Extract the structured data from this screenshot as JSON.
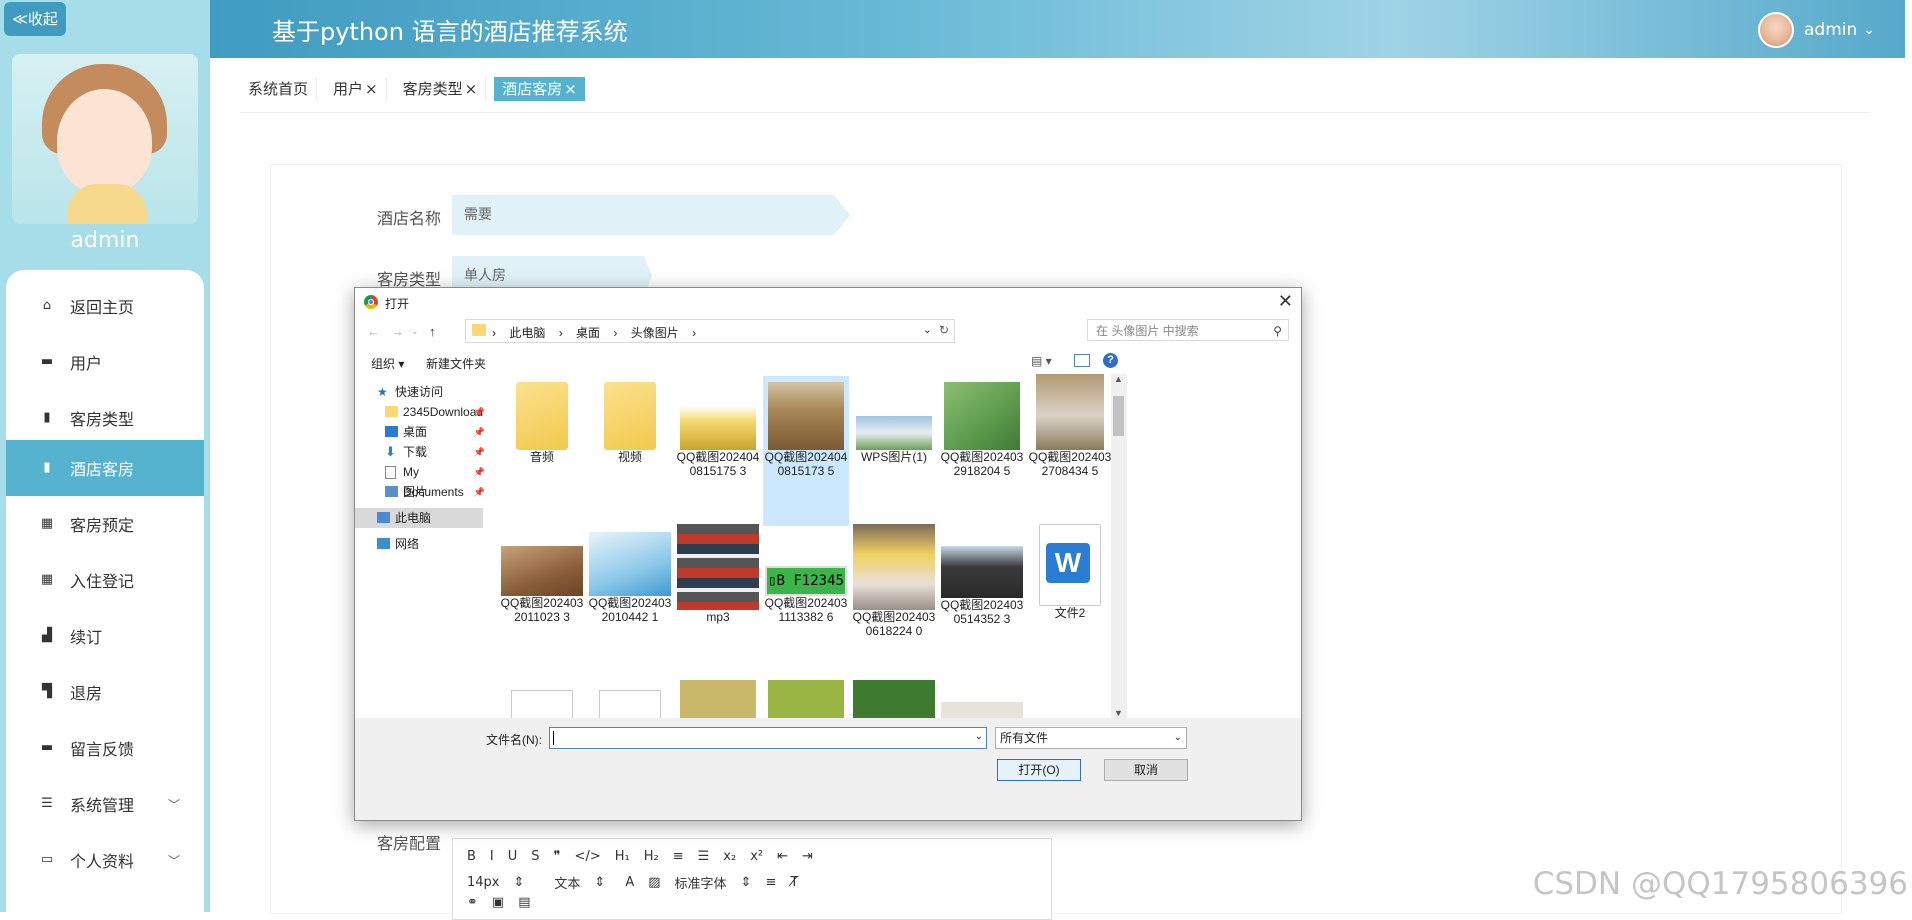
{
  "header": {
    "title": "基于python 语言的酒店推荐系统",
    "username": "admin"
  },
  "sidebar": {
    "collapse_label": "≪收起",
    "name": "admin",
    "items": [
      {
        "label": "返回主页",
        "icon": "home-icon"
      },
      {
        "label": "用户",
        "icon": "monitor-icon"
      },
      {
        "label": "客房类型",
        "icon": "clipboard-icon"
      },
      {
        "label": "酒店客房",
        "icon": "clipboard-icon"
      },
      {
        "label": "客房预定",
        "icon": "grid-icon"
      },
      {
        "label": "入住登记",
        "icon": "grid-icon"
      },
      {
        "label": "续订",
        "icon": "thumb-icon"
      },
      {
        "label": "退房",
        "icon": "thumb-icon"
      },
      {
        "label": "留言反馈",
        "icon": "monitor-icon"
      },
      {
        "label": "系统管理",
        "icon": "sliders-icon"
      },
      {
        "label": "个人资料",
        "icon": "card-icon"
      }
    ]
  },
  "tabs": [
    {
      "label": "系统首页",
      "closable": ""
    },
    {
      "label": "用户",
      "closable": "×"
    },
    {
      "label": "客房类型",
      "closable": "×"
    },
    {
      "label": "酒店客房",
      "closable": "×"
    }
  ],
  "form": {
    "hotel_name_label": "酒店名称",
    "hotel_name_value": "需要",
    "room_type_label": "客房类型",
    "room_type_value": "单人房",
    "config_label": "客房配置",
    "editor": {
      "row1": [
        "B",
        "I",
        "U",
        "S",
        "❞",
        "</>",
        "H₁",
        "H₂",
        "≡",
        "☰",
        "x₂",
        "x²",
        "⇤",
        "⇥"
      ],
      "font_size": "14px",
      "text_style": "文本",
      "font_family": "标准字体"
    }
  },
  "dialog": {
    "title": "打开",
    "breadcrumb": [
      "此电脑",
      "桌面",
      "头像图片"
    ],
    "search_placeholder": "在 头像图片 中搜索",
    "organize": "组织 ▾",
    "new_folder": "新建文件夹",
    "nav": [
      {
        "label": "快速访问"
      },
      {
        "label": "2345Download"
      },
      {
        "label": "桌面"
      },
      {
        "label": "下载"
      },
      {
        "label": "My Documents"
      },
      {
        "label": "图片"
      },
      {
        "label": "此电脑"
      },
      {
        "label": "网络"
      }
    ],
    "files": [
      {
        "name": "音频"
      },
      {
        "name": "视频"
      },
      {
        "name": "QQ截图2024040815175 3"
      },
      {
        "name": "QQ截图2024040815173 5"
      },
      {
        "name": "WPS图片(1)"
      },
      {
        "name": "QQ截图2024032918204 5"
      },
      {
        "name": "QQ截图2024032708434 5"
      },
      {
        "name": "QQ截图2024032011023 3"
      },
      {
        "name": "QQ截图2024032010442 1"
      },
      {
        "name": "mp3"
      },
      {
        "name": "QQ截图2024031113382 6"
      },
      {
        "name": "QQ截图2024030618224 0"
      },
      {
        "name": "QQ截图2024030514352 3"
      },
      {
        "name": "文件2"
      }
    ],
    "filename_label": "文件名(N):",
    "filename_value": "",
    "filetype": "所有文件",
    "open_button": "打开(O)",
    "cancel_button": "取消"
  },
  "watermark": "CSDN @QQ1795806396",
  "colors": {
    "accent": "#56b3cf",
    "sidebar_bg": "#a7dde9",
    "header": "#4aa6c9"
  }
}
